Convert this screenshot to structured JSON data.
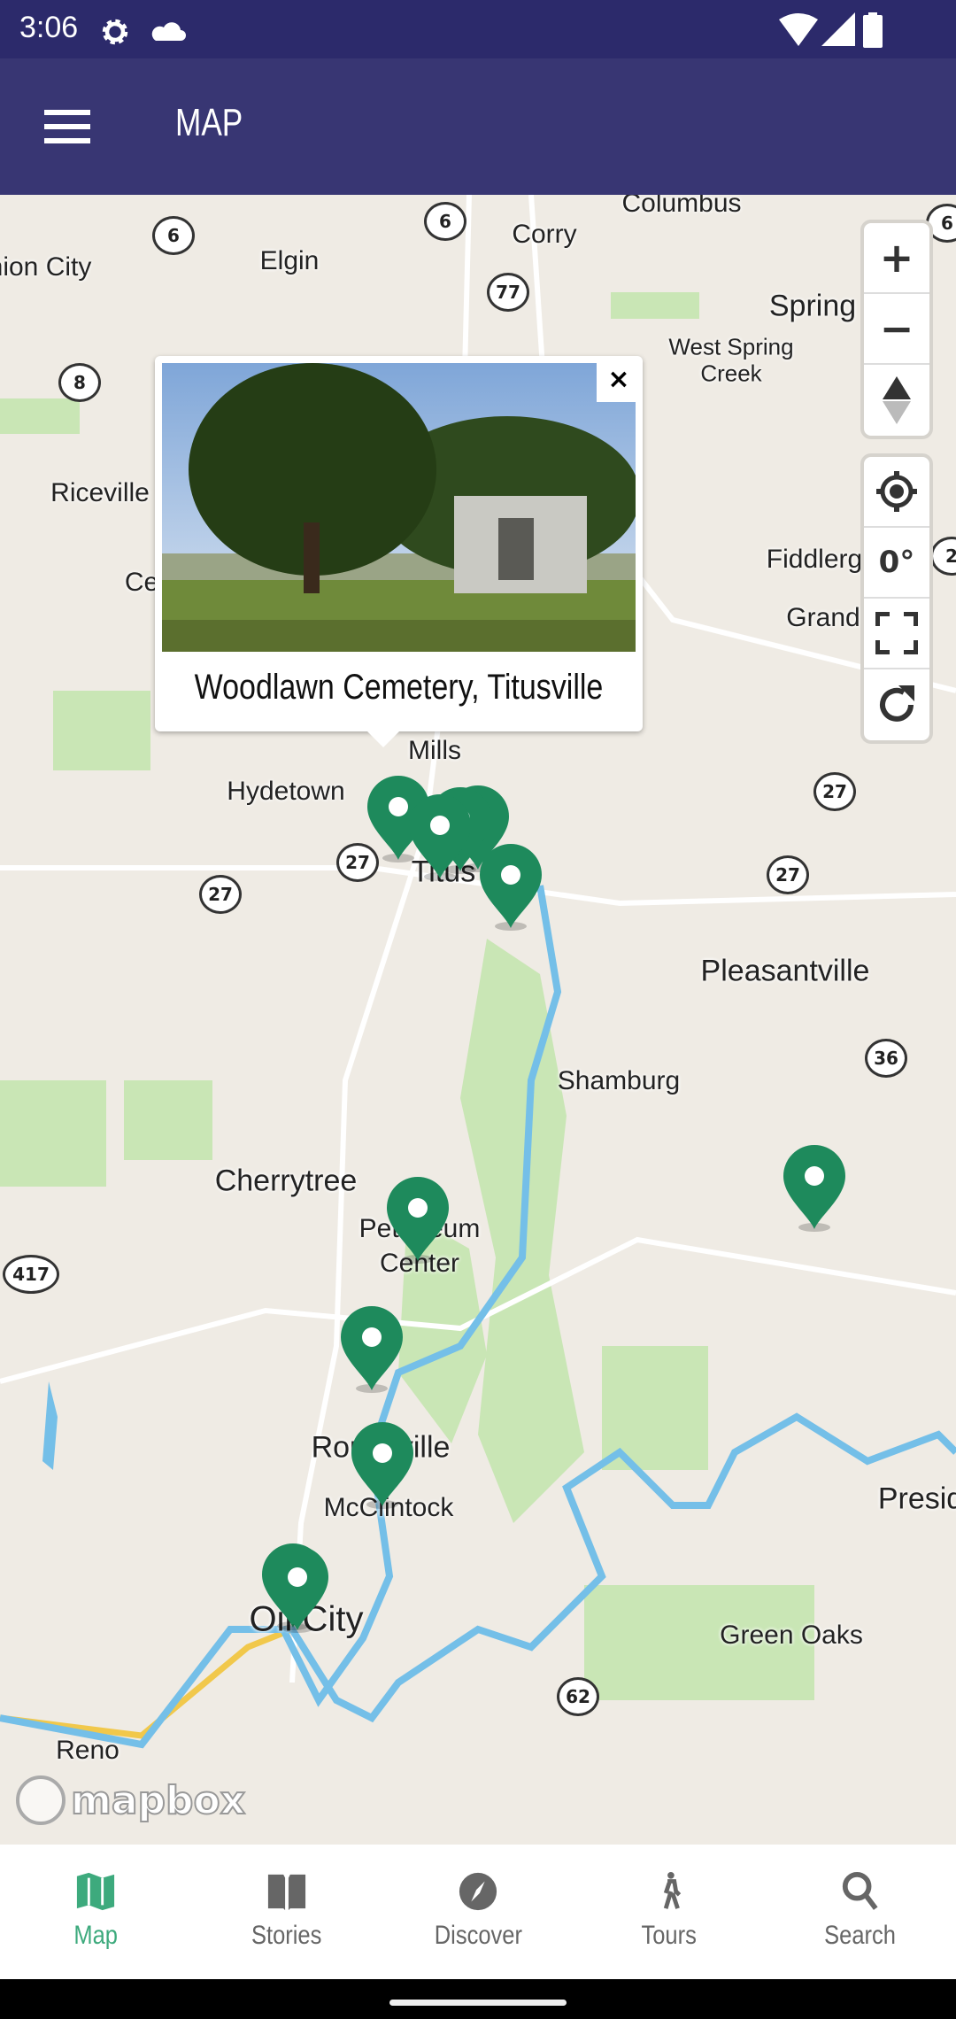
{
  "status_bar": {
    "time": "3:06",
    "icons": [
      "gear-icon",
      "cloud-icon",
      "wifi-icon",
      "signal-icon",
      "battery-icon"
    ]
  },
  "app_bar": {
    "title": "MAP",
    "menu_icon": "hamburger-menu-icon"
  },
  "map": {
    "places": [
      "Columbus",
      "Corry",
      "Elgin",
      "nion City",
      "Spring C",
      "West Spring",
      "Creek",
      "Riceville",
      "Ce",
      "Fiddlerg",
      "Grand",
      "Mills",
      "Hydetown",
      "Titus",
      "Pleasantville",
      "Shamburg",
      "Cherrytree",
      "Petroleum",
      "Center",
      "Rouseville",
      "McClintock",
      "Oil City",
      "Presid",
      "Green Oaks",
      "Reno"
    ],
    "routes": [
      "6",
      "6",
      "77",
      "8",
      "27",
      "27",
      "27",
      "27",
      "36",
      "417",
      "62",
      "6",
      "2"
    ],
    "popup": {
      "title": "Woodlawn Cemetery, Titusville",
      "close": "×"
    },
    "controls": {
      "zoom_in": "+",
      "zoom_out": "−",
      "compass": "▲",
      "locate": "locate-icon",
      "bearing": "0°",
      "fullscreen": "fullscreen-icon",
      "reset": "refresh-icon"
    },
    "attribution": "mapbox",
    "marker_color": "#1e8a5c"
  },
  "bottom_nav": {
    "active_color": "#3daa7d",
    "items": [
      {
        "label": "Map",
        "icon": "map-icon"
      },
      {
        "label": "Stories",
        "icon": "book-icon"
      },
      {
        "label": "Discover",
        "icon": "compass-icon"
      },
      {
        "label": "Tours",
        "icon": "walking-icon"
      },
      {
        "label": "Search",
        "icon": "search-icon"
      }
    ]
  }
}
